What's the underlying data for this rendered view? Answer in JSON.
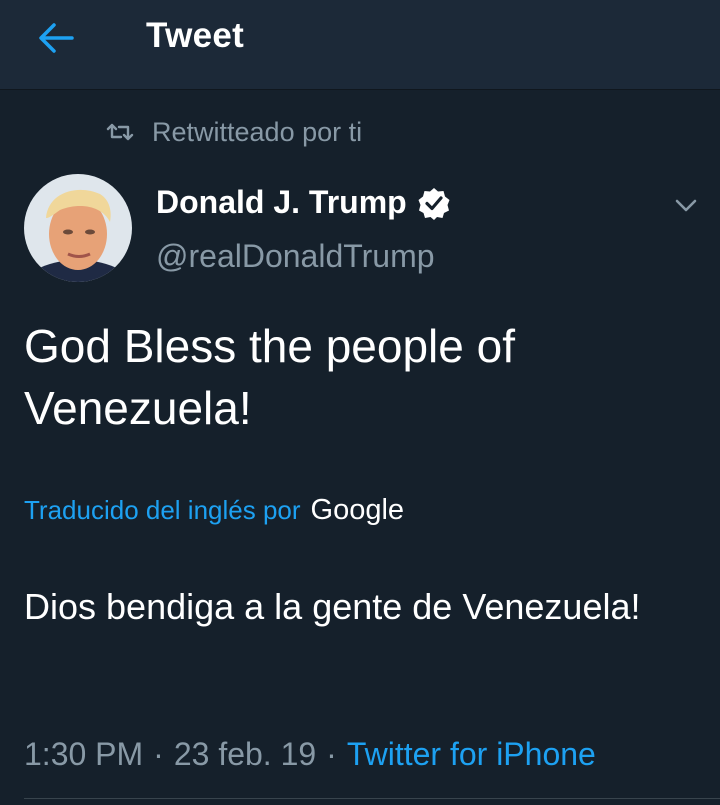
{
  "header": {
    "title": "Tweet",
    "back_icon": "arrow-left-icon"
  },
  "retweet": {
    "label": "Retwitteado por ti",
    "icon": "retweet-icon"
  },
  "author": {
    "name": "Donald J. Trump",
    "handle": "@realDonaldTrump",
    "verified": true,
    "avatar_icon": "avatar-photo"
  },
  "tweet": {
    "text": "God Bless the people of Venezuela!"
  },
  "translation": {
    "label": "Traducido del inglés por",
    "provider": "Google",
    "text": "Dios bendiga a la gente de Venezuela!"
  },
  "meta": {
    "time": "1:30 PM",
    "separator": "·",
    "date": "23 feb. 19",
    "source": "Twitter for iPhone"
  },
  "colors": {
    "background": "#15202b",
    "header_background": "#1c2938",
    "accent": "#1da1f2",
    "secondary_text": "#8899a6",
    "primary_text": "#ffffff"
  }
}
